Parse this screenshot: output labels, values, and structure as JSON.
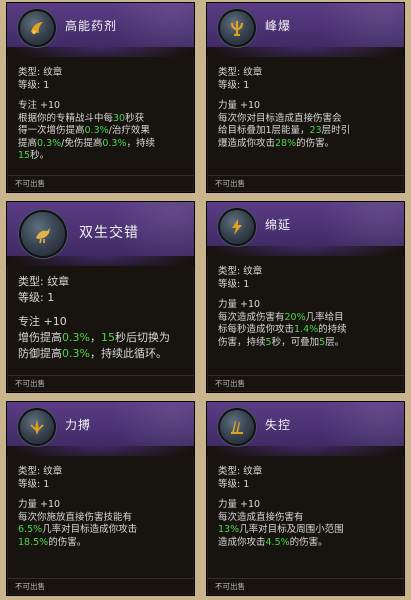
{
  "cards": [
    {
      "id": "gaoneng",
      "title": "高能药剂",
      "icon": "potion-icon",
      "type_label": "类型: 纹章",
      "level_label": "等级: 1",
      "stat": "专注 +10",
      "desc": [
        {
          "t": "根据你的专精战斗中每"
        },
        {
          "t": "30",
          "hi": true
        },
        {
          "t": "秒获\n得一次增伤提高"
        },
        {
          "t": "0.3%",
          "hi": true
        },
        {
          "t": "/治疗效果\n提高"
        },
        {
          "t": "0.3%",
          "hi": true
        },
        {
          "t": "/免伤提高"
        },
        {
          "t": "0.3%",
          "hi": true
        },
        {
          "t": "，持续\n"
        },
        {
          "t": "15",
          "hi": true
        },
        {
          "t": "秒。"
        }
      ],
      "footer": "不可出售"
    },
    {
      "id": "fengbao",
      "title": "峰爆",
      "icon": "trident-icon",
      "type_label": "类型: 纹章",
      "level_label": "等级: 1",
      "stat": "力量 +10",
      "desc": [
        {
          "t": "每次你对目标造成直接伤害会\n给目标叠加1层能量，"
        },
        {
          "t": "23",
          "hi": true
        },
        {
          "t": "层时引\n爆造成你攻击"
        },
        {
          "t": "28%",
          "hi": true
        },
        {
          "t": "的伤害。"
        }
      ],
      "footer": "不可出售"
    },
    {
      "id": "shuangsheng",
      "title": "双生交错",
      "icon": "bird-icon",
      "type_label": "类型: 纹章",
      "level_label": "等级: 1",
      "stat": "专注 +10",
      "desc": [
        {
          "t": "增伤提高"
        },
        {
          "t": "0.3%",
          "hi": true
        },
        {
          "t": "，"
        },
        {
          "t": "15",
          "hi": true
        },
        {
          "t": "秒后切换为\n防御提高"
        },
        {
          "t": "0.3%",
          "hi": true
        },
        {
          "t": "，持续此循环。"
        }
      ],
      "footer": "不可出售"
    },
    {
      "id": "mianyan",
      "title": "绵延",
      "icon": "lightning-icon",
      "type_label": "类型: 纹章",
      "level_label": "等级: 1",
      "stat": "力量 +10",
      "desc": [
        {
          "t": "每次造成伤害有"
        },
        {
          "t": "20%",
          "hi": true
        },
        {
          "t": "几率给目\n标每秒造成你攻击"
        },
        {
          "t": "1.4%",
          "hi": true
        },
        {
          "t": "的持续\n伤害，持续"
        },
        {
          "t": "5",
          "hi": true
        },
        {
          "t": "秒，可叠加"
        },
        {
          "t": "5",
          "hi": true
        },
        {
          "t": "层。"
        }
      ],
      "footer": "不可出售"
    },
    {
      "id": "libo",
      "title": "力搏",
      "icon": "blade-icon",
      "type_label": "类型: 纹章",
      "level_label": "等级: 1",
      "stat": "力量 +10",
      "desc": [
        {
          "t": "每次你施放直接伤害技能有\n"
        },
        {
          "t": "6.5%",
          "hi": true
        },
        {
          "t": "几率对目标造成你攻击\n"
        },
        {
          "t": "18.5%",
          "hi": true
        },
        {
          "t": "的伤害。"
        }
      ],
      "footer": "不可出售"
    },
    {
      "id": "shikong",
      "title": "失控",
      "icon": "claw-icon",
      "type_label": "类型: 纹章",
      "level_label": "等级: 1",
      "stat": "力量 +10",
      "desc": [
        {
          "t": "每次造成直接伤害有\n"
        },
        {
          "t": "13%",
          "hi": true
        },
        {
          "t": "几率对目标及周围小范围\n造成你攻击"
        },
        {
          "t": "4.5%",
          "hi": true
        },
        {
          "t": "的伤害。"
        }
      ],
      "footer": "不可出售"
    }
  ],
  "colors": {
    "highlight": "#4fd44f",
    "header_purple": "#4a3272",
    "icon_gold": "#e0a020",
    "card_bg": "#17130f",
    "page_bg": "#c9b48e"
  }
}
